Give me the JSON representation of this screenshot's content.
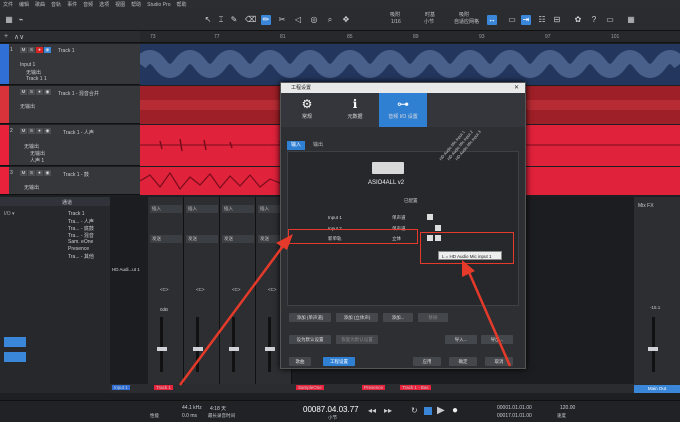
{
  "menu": [
    "文件",
    "编辑",
    "歌曲",
    "音轨",
    "事件",
    "音频",
    "选项",
    "视图",
    "帮助",
    "Studio Pro",
    "帮助"
  ],
  "toolbar": {
    "snap_label": "吸附",
    "snap_value": "1/16",
    "timebase_label": "时基",
    "timebase_value": "小节",
    "quantize_label": "吸附",
    "quantize_value": "自适应网格"
  },
  "ruler": [
    "73",
    "77",
    "81",
    "85",
    "89",
    "93",
    "97",
    "101"
  ],
  "tracks": [
    {
      "num": "1",
      "name": "Track 1",
      "input": "Input 1",
      "sub1": "无输出",
      "sub2": "Track 1 1",
      "color": "#2f6fd6"
    },
    {
      "num": "",
      "name": "Track 1 - 混音合并",
      "input": "",
      "sub1": "无输出",
      "sub2": "",
      "color": "#d8333b"
    },
    {
      "num": "2",
      "name": "Track 1 - 人声",
      "input": "无输出",
      "sub1": "无输出",
      "sub2": "人声 1",
      "color": "#e8223a"
    },
    {
      "num": "3",
      "name": "Track 1 - 鼓",
      "input": "无输出",
      "sub1": "",
      "sub2": "",
      "color": "#e8223a"
    }
  ],
  "inspector": {
    "header": "通道",
    "rows": [
      "Track 1",
      "Tra... - 人声",
      "Tra... - 底鼓",
      "Tra... - 混音",
      "Sam. eOne",
      "Presence",
      "Tra... - 其他"
    ]
  },
  "mixer": {
    "insert_label": "插入",
    "send_label": "发送",
    "input_name": "HD Audi...ut 1",
    "strips": [
      {
        "label": "Track 1",
        "color": "#2f6fd6"
      },
      {
        "label": "Track 1 - 混",
        "color": "#e8223a"
      },
      {
        "label": "Track 1 - 人",
        "color": "#e8223a"
      },
      {
        "label": "Track 1 - 人",
        "color": "#e8223a"
      },
      {
        "label": "Track 1 - 鼓",
        "color": "#e8223a"
      }
    ],
    "bottom_labels": [
      "Input 1",
      "Track 1",
      "Track 1",
      "Track 1",
      "Track 1",
      "Track 1",
      "SampleOne",
      "Track 1",
      "Presence",
      "Track 1 - Bas"
    ],
    "fx_label": "Mix FX",
    "main_out": "Main Out",
    "db": "-15.1",
    "pan": "<C>",
    "zero": "0dB"
  },
  "dialog": {
    "title": "工程设置",
    "tabs": [
      "常规",
      "元数据",
      "音频 I/O 设置"
    ],
    "subtabs": [
      "输入",
      "输出"
    ],
    "device": "ASIO4ALL v2",
    "column_header": "已配置",
    "rows": [
      {
        "name": "Input 1",
        "type": "单声道"
      },
      {
        "name": "Input 2",
        "type": "单声道"
      },
      {
        "name": "新单轨",
        "type": "立体"
      }
    ],
    "channels": [
      "HD Audio Mic input 1",
      "HD Audio Mic input 2",
      "HD Audio Mic input 3"
    ],
    "buttons": {
      "add_mono": "添加 (单声道)",
      "add_stereo": "添加 (立体声)",
      "add": "添加...",
      "remove": "移除",
      "set_default": "设为默认设置",
      "restore_default": "恢复为默认设置",
      "import": "导入...",
      "export": "导出...",
      "song": "歌曲",
      "project_settings": "工程设置",
      "apply": "应用",
      "ok": "确定",
      "cancel": "取消"
    },
    "tooltip": "L = HD Audio Mic input 1"
  },
  "transport": {
    "sample_rate": "44.1 kHz",
    "latency": "0.0 ms",
    "duration": "4:18 天",
    "record_max": "最长录音时间",
    "position": "00087.04.03.77",
    "position_label": "小节",
    "loop_start": "00001.01.01.00",
    "loop_end": "00017.01.01.00",
    "tempo": "120.00",
    "tempo_label": "速度",
    "performance": "性能"
  }
}
